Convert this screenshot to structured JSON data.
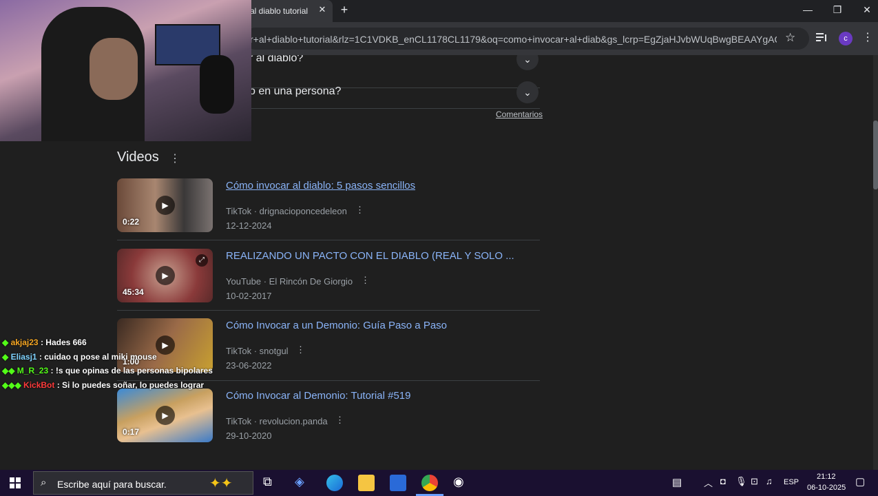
{
  "browser": {
    "tab_title": "al diablo tutorial",
    "url": "r+al+diablo+tutorial&rlz=1C1VDKB_enCL1178CL1179&oq=como+invocar+al+diab&gs_lcrp=EgZjaHJvbWUqBwgBEAAYgAQyBgg...",
    "profile_initial": "c"
  },
  "faq": [
    {
      "text": "r al diablo?"
    },
    {
      "text": "o en una persona?"
    }
  ],
  "comentarios_label": "Comentarios",
  "videos": {
    "heading": "Videos",
    "items": [
      {
        "title": "Cómo invocar al diablo: 5 pasos sencillos",
        "platform": "TikTok",
        "channel": "drignacioponcedeleon",
        "date": "12-12-2024",
        "duration": "0:22"
      },
      {
        "title": "REALIZANDO UN PACTO CON EL DIABLO (REAL Y SOLO ...",
        "platform": "YouTube",
        "channel": "El Rincón De Giorgio",
        "date": "10-02-2017",
        "duration": "45:34"
      },
      {
        "title": "Cómo Invocar a un Demonio: Guía Paso a Paso",
        "platform": "TikTok",
        "channel": "snotgul",
        "date": "23-06-2022",
        "duration": "1:00"
      },
      {
        "title": "Cómo Invocar al Demonio: Tutorial #519",
        "platform": "TikTok",
        "channel": "revolucion.panda",
        "date": "29-10-2020",
        "duration": "0:17"
      }
    ]
  },
  "chat": [
    {
      "user": "akjaj23",
      "msg": " : Hades 666",
      "color": "#f5a623"
    },
    {
      "user": "Eliasj1",
      "msg": " : cuidao q pose al miki mouse",
      "color": "#7fd3ff"
    },
    {
      "user": "M_R_23",
      "msg": " : !s que opinas de las personas bipolares",
      "color": "#53fc18"
    },
    {
      "user": "KickBot",
      "msg": " : Si lo puedes soñar, lo puedes lograr",
      "color": "#ff3b3b"
    }
  ],
  "taskbar": {
    "search_placeholder": "Escribe aquí para buscar.",
    "lang": "ESP",
    "time": "21:12",
    "date": "06-10-2025"
  }
}
